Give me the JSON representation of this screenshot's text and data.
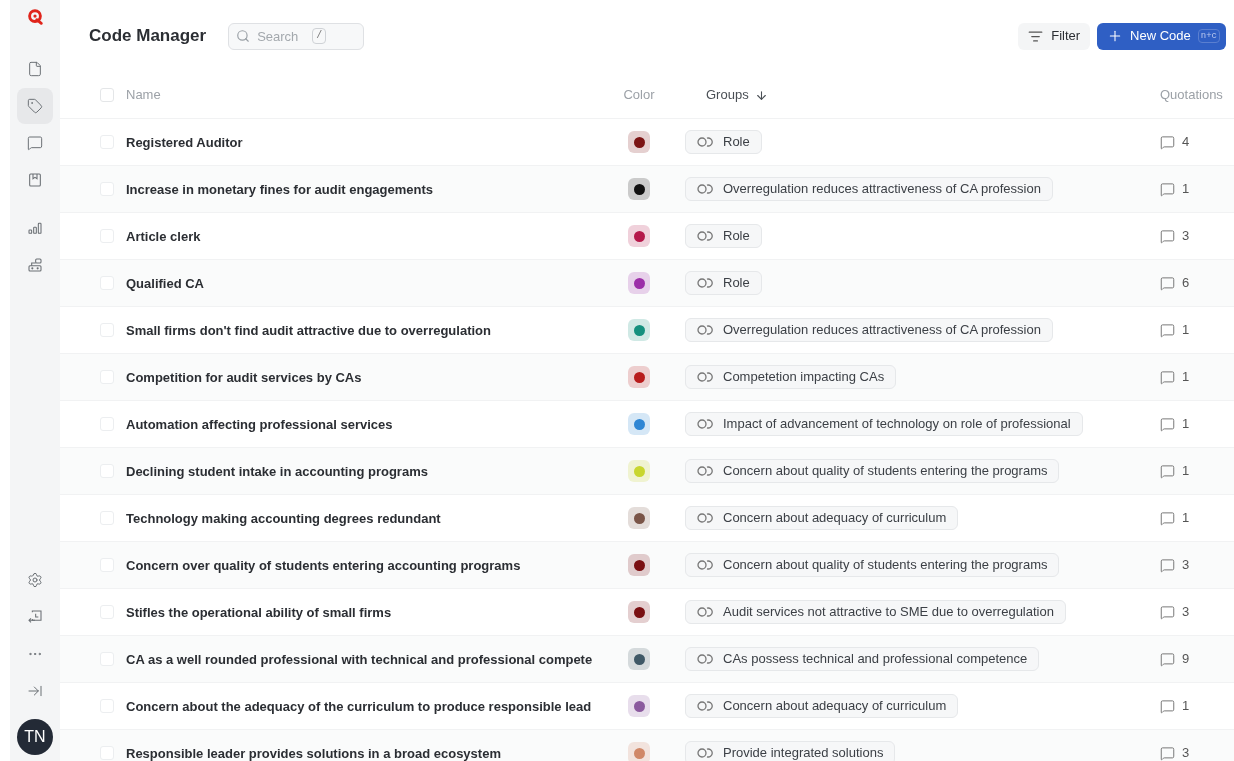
{
  "sidebar": {
    "items": [
      {
        "kind": "file",
        "selected": false
      },
      {
        "kind": "tag",
        "selected": true
      },
      {
        "kind": "comment",
        "selected": false
      },
      {
        "kind": "bookmark",
        "selected": false
      },
      {
        "kind": "chart",
        "selected": false
      },
      {
        "kind": "network",
        "selected": false
      }
    ],
    "bottom_items": [
      {
        "kind": "settings"
      },
      {
        "kind": "import"
      },
      {
        "kind": "more"
      },
      {
        "kind": "collapse"
      }
    ],
    "avatar": "TN"
  },
  "header": {
    "title": "Code Manager",
    "search": {
      "placeholder": "Search",
      "shortcut": "/"
    },
    "filter_button": "Filter",
    "new_button": {
      "label": "New Code",
      "shortcut": "n+c"
    }
  },
  "table": {
    "select_all_checked": false,
    "columns": [
      "Name",
      "Color",
      "Groups",
      "Quotations"
    ],
    "rows": [
      {
        "name": "Registered Auditor",
        "color": "#7b1414",
        "group": "Role",
        "quotations": "4",
        "checked": false
      },
      {
        "name": "Increase in monetary fines for audit engagements",
        "color": "#111111",
        "group": "Overregulation reduces attractiveness of CA profession",
        "quotations": "1",
        "checked": false
      },
      {
        "name": "Article clerk",
        "color": "#b5184a",
        "group": "Role",
        "quotations": "3",
        "checked": false
      },
      {
        "name": "Qualified CA",
        "color": "#9c2fa8",
        "group": "Role",
        "quotations": "6",
        "checked": false
      },
      {
        "name": "Small firms don't find audit attractive due to overregulation",
        "color": "#14907e",
        "group": "Overregulation reduces attractiveness of CA profession",
        "quotations": "1",
        "checked": false
      },
      {
        "name": "Competition for audit services by CAs",
        "color": "#b81c1c",
        "group": "Competetion impacting CAs",
        "quotations": "1",
        "checked": false
      },
      {
        "name": "Automation affecting professional services",
        "color": "#2e86d4",
        "group": "Impact of advancement of technology on role of professional",
        "quotations": "1",
        "checked": false
      },
      {
        "name": "Declining student intake in accounting programs",
        "color": "#c8d62e",
        "group": "Concern about quality of students entering the programs",
        "quotations": "1",
        "checked": false
      },
      {
        "name": "Technology making accounting degrees redundant",
        "color": "#7a5548",
        "group": "Concern about adequacy of curriculum",
        "quotations": "1",
        "checked": false
      },
      {
        "name": "Concern over quality of students entering accounting programs",
        "color": "#7a0f12",
        "group": "Concern about quality of students entering the programs",
        "quotations": "3",
        "checked": false
      },
      {
        "name": "Stifles the operational ability of small firms",
        "color": "#7a0f12",
        "group": "Audit services not attractive to SME due to overregulation",
        "quotations": "3",
        "checked": false
      },
      {
        "name": "CA as a well rounded professional with technical and professional compete",
        "color": "#3f5866",
        "group": "CAs possess technical and professional competence",
        "quotations": "9",
        "checked": false
      },
      {
        "name": "Concern about the adequacy of the curriculum to produce responsible lead",
        "color": "#8b5a9e",
        "group": "Concern about adequacy of curriculum",
        "quotations": "1",
        "checked": false
      },
      {
        "name": "Responsible leader provides solutions in a broad ecosystem",
        "color": "#d08868",
        "group": "Provide integrated solutions",
        "quotations": "3",
        "checked": false
      }
    ]
  }
}
